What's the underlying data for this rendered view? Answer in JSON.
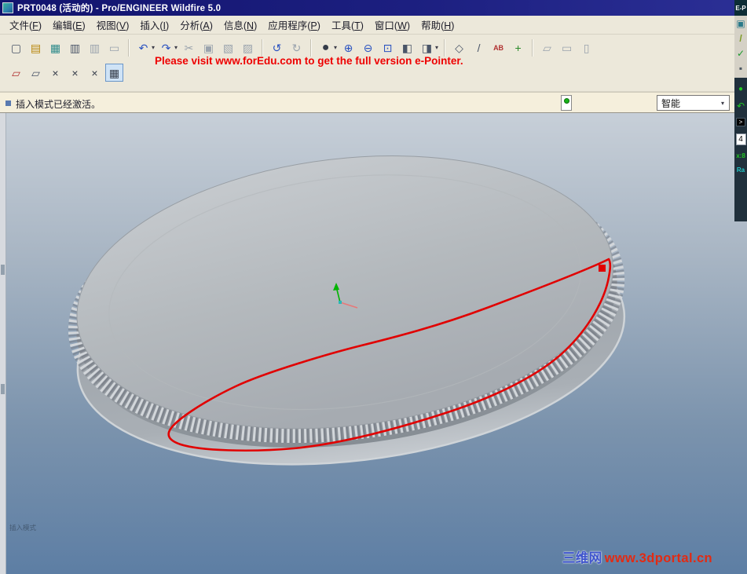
{
  "titlebar": {
    "title": "PRT0048 (活动的) - Pro/ENGINEER Wildfire 5.0"
  },
  "menubar": {
    "items": [
      {
        "pre": "文件(",
        "key": "F",
        "post": ")"
      },
      {
        "pre": "编辑(",
        "key": "E",
        "post": ")"
      },
      {
        "pre": "视图(",
        "key": "V",
        "post": ")"
      },
      {
        "pre": "插入(",
        "key": "I",
        "post": ")"
      },
      {
        "pre": "分析(",
        "key": "A",
        "post": ")"
      },
      {
        "pre": "信息(",
        "key": "N",
        "post": ")"
      },
      {
        "pre": "应用程序(",
        "key": "P",
        "post": ")"
      },
      {
        "pre": "工具(",
        "key": "T",
        "post": ")"
      },
      {
        "pre": "窗口(",
        "key": "W",
        "post": ")"
      },
      {
        "pre": "帮助(",
        "key": "H",
        "post": ")"
      }
    ]
  },
  "toolbar_main": {
    "caret": "▾",
    "overlay_text": "Please visit www.forEdu.com to get the full version e-Pointer.",
    "icons": [
      {
        "name": "new-file",
        "glyph": "▢"
      },
      {
        "name": "open",
        "glyph": "▤"
      },
      {
        "name": "save",
        "glyph": "▦"
      },
      {
        "name": "print",
        "glyph": "▥"
      },
      {
        "name": "print-preview",
        "glyph": "▥"
      },
      {
        "name": "plot",
        "glyph": "▭"
      },
      {
        "name": "undo",
        "glyph": "↶"
      },
      {
        "name": "redo",
        "glyph": "↷"
      },
      {
        "name": "cut",
        "glyph": "✂"
      },
      {
        "name": "copy",
        "glyph": "▣"
      },
      {
        "name": "paste",
        "glyph": "▧"
      },
      {
        "name": "paste-special",
        "glyph": "▨"
      },
      {
        "name": "regenerate",
        "glyph": "↺"
      },
      {
        "name": "auto-regenerate",
        "glyph": "↻"
      },
      {
        "name": "shading-mode",
        "glyph": "●"
      },
      {
        "name": "zoom-in",
        "glyph": "⊕"
      },
      {
        "name": "zoom-out",
        "glyph": "⊖"
      },
      {
        "name": "refit",
        "glyph": "⊡"
      },
      {
        "name": "repaint",
        "glyph": "◧"
      },
      {
        "name": "saved-orientations",
        "glyph": "◨"
      },
      {
        "name": "datum-planes",
        "glyph": "◇"
      },
      {
        "name": "datum-axes",
        "glyph": "/"
      },
      {
        "name": "annotations",
        "glyph": "AB"
      },
      {
        "name": "spin-center",
        "glyph": "+"
      },
      {
        "name": "window-1",
        "glyph": "▱"
      },
      {
        "name": "window-2",
        "glyph": "▭"
      },
      {
        "name": "window-3",
        "glyph": "▯"
      }
    ]
  },
  "toolbar_sketch": {
    "icons": [
      {
        "name": "sketch-plane",
        "glyph": "▱"
      },
      {
        "name": "sketch-setup",
        "glyph": "▱"
      },
      {
        "name": "delete-segment",
        "glyph": "×"
      },
      {
        "name": "corner-trim",
        "glyph": "×"
      },
      {
        "name": "divide-entity",
        "glyph": "×"
      },
      {
        "name": "sketch-view",
        "glyph": "▦"
      }
    ]
  },
  "statusbar": {
    "message": "插入模式已经激活。",
    "filter_label": "智能",
    "caret": "▾"
  },
  "viewport": {
    "corner_text": "插入模式",
    "watermark_site_name": "三维网",
    "watermark_url": "www.3dportal.cn"
  },
  "right_rail": {
    "title": "E-P",
    "tool_1": "▣",
    "tool_2": "/",
    "tool_3": "✓",
    "tool_4": "▪",
    "status_light": "●",
    "undo_glyph": "↶",
    "prompt": ">",
    "value": "4",
    "x_label": "x:8",
    "ra_label": "Ra"
  }
}
